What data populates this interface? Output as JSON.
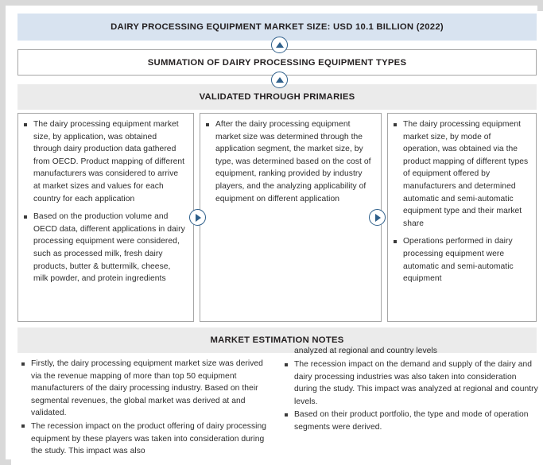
{
  "banners": {
    "top_title": "DAIRY PROCESSING  EQUIPMENT  MARKET SIZE: USD 10.1 BILLION  (2022)",
    "summation": "SUMMATION OF DAIRY PROCESSING EQUIPMENT TYPES",
    "validated": "VALIDATED THROUGH PRIMARIES",
    "notes_header": "MARKET ESTIMATION NOTES"
  },
  "colors": {
    "top_band": "#d8e3f0",
    "gray_band": "#ebebeb",
    "frame": "#d9d9d9",
    "arrow": "#2e5f8a",
    "box_border": "#a6a6a6",
    "text": "#2b2b2b"
  },
  "columns": [
    {
      "id": "application",
      "bullets": [
        "The dairy processing equipment market size, by application, was obtained through dairy production data gathered from OECD. Product mapping of different manufacturers was considered to arrive at market sizes and values for each country for each application",
        "Based on the production volume and OECD data, different applications in dairy processing equipment were considered, such as processed milk, fresh dairy products, butter & buttermilk, cheese, milk powder, and protein ingredients"
      ]
    },
    {
      "id": "type",
      "bullets": [
        "After the dairy processing equipment market size was determined through the application segment, the market size, by type, was determined based on the cost of equipment, ranking provided  by industry players, and the analyzing applicability of equipment on different application"
      ]
    },
    {
      "id": "mode-of-operation",
      "bullets": [
        "The dairy processing equipment market size, by mode of operation, was obtained via the product mapping of different types of equipment offered by manufacturers and determined automatic and semi-automatic equipment type and their market share",
        "Operations performed in dairy processing equipment were automatic and semi-automatic equipment"
      ]
    }
  ],
  "notes": {
    "left_bullets": [
      "Firstly, the dairy processing equipment market size was derived via the revenue mapping of more than top 50 equipment manufacturers of the dairy processing industry. Based on their segmental revenues, the global  market was derived at and validated.",
      "The recession impact on the product offering of dairy processing equipment by these players  was taken into consideration during the study. This impact was also"
    ],
    "right_bullets": [
      "analyzed at regional and country levels",
      "The recession impact on the demand and supply of the dairy and dairy processing industries was also taken into consideration during the study. This impact was analyzed at regional and country levels.",
      "Based on their product portfolio, the type and mode of operation segments were derived."
    ]
  },
  "icons": {
    "arrow_up_1": "triangle-up-icon",
    "arrow_up_2": "triangle-up-icon",
    "arrow_right_1": "triangle-right-icon",
    "arrow_right_2": "triangle-right-icon"
  }
}
